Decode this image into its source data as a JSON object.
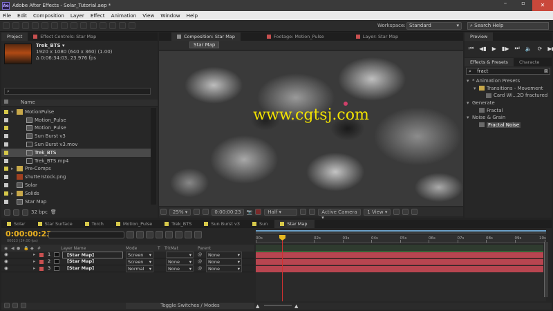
{
  "titlebar": {
    "icon": "after-effects-logo",
    "title": "Adobe After Effects - Solar_Tutorial.aep *"
  },
  "menu": [
    "File",
    "Edit",
    "Composition",
    "Layer",
    "Effect",
    "Animation",
    "View",
    "Window",
    "Help"
  ],
  "toolbar": {
    "workspace_label": "Workspace:",
    "workspace_value": "Standard",
    "search_placeholder": "Search Help"
  },
  "project_panel": {
    "tabs": [
      "Project",
      "Effect Controls: Star Map"
    ],
    "preview_name": "Trek_BTS",
    "preview_info": [
      "1920 x 1080  (640 x 360) (1.00)",
      "Δ 0:06:34:03, 23.976 fps"
    ],
    "column_header": "Name",
    "items": [
      {
        "label": "MotionPulse",
        "type": "folder",
        "color": "#d6c84a",
        "indent": 0,
        "expanded": true
      },
      {
        "label": "Motion_Pulse",
        "type": "comp",
        "color": "#c8c8c8",
        "indent": 1
      },
      {
        "label": "Motion_Pulse",
        "type": "comp",
        "color": "#d6c84a",
        "indent": 1
      },
      {
        "label": "Sun Burst v3",
        "type": "comp",
        "color": "#c8c8c8",
        "indent": 1
      },
      {
        "label": "Sun Burst v3.mov",
        "type": "footage",
        "color": "#c8c8c8",
        "indent": 1
      },
      {
        "label": "Trek_BTS",
        "type": "comp",
        "color": "#d6c84a",
        "indent": 1,
        "selected": true
      },
      {
        "label": "Trek_BTS.mp4",
        "type": "footage",
        "color": "#c8c8c8",
        "indent": 1
      },
      {
        "label": "Pre-Comps",
        "type": "folder",
        "color": "#d6c84a",
        "indent": 0
      },
      {
        "label": "shutterstock.png",
        "type": "image",
        "color": "#c8c8c8",
        "indent": 0
      },
      {
        "label": "Solar",
        "type": "comp",
        "color": "#c8c8c8",
        "indent": 0
      },
      {
        "label": "Solids",
        "type": "folder",
        "color": "#d6c84a",
        "indent": 0
      },
      {
        "label": "Star Map",
        "type": "comp",
        "color": "#c8c8c8",
        "indent": 0
      }
    ],
    "bpc": "32 bpc"
  },
  "viewer": {
    "tabs": [
      "Composition: Star Map",
      "Footage: Motion_Pulse",
      "Layer: Star Map"
    ],
    "tab_colors": [
      "#8c8c8c",
      "#c85050",
      "#c85050"
    ],
    "breadcrumb": "Star Map",
    "watermark": "www.cgtsj.com",
    "footer": {
      "zoom": "25%",
      "timecode": "0:00:00:23",
      "resolution": "Half",
      "camera": "Active Camera",
      "view": "1 View"
    }
  },
  "preview_panel": {
    "title": "Preview"
  },
  "effects_panel": {
    "tabs": [
      "Effects & Presets",
      "Characte"
    ],
    "search_value": "fract",
    "tree": [
      {
        "label": "* Animation Presets",
        "level": 0
      },
      {
        "label": "Transitions - Movement",
        "level": 1
      },
      {
        "label": "Card Wi...2D fractured",
        "level": 2
      },
      {
        "label": "Generate",
        "level": 0
      },
      {
        "label": "Fractal",
        "level": 1
      },
      {
        "label": "Noise & Grain",
        "level": 0
      },
      {
        "label": "Fractal Noise",
        "level": 1,
        "selected": true
      }
    ]
  },
  "timeline": {
    "tabs": [
      "Solar",
      "Star Surface",
      "Torch",
      "Motion_Pulse",
      "Trek_BTS",
      "Sun Burst v3",
      "Sun",
      "Star Map"
    ],
    "tab_colors": [
      "#d6c84a",
      "#d6c84a",
      "#d6c84a",
      "#d6c84a",
      "#d6c84a",
      "#d6c84a",
      "#d6c84a",
      "#d6c84a"
    ],
    "timecode": "0:00:00:23",
    "frame_info": "00023 (24.00 fps)",
    "columns": {
      "layer_name": "Layer Name",
      "mode": "Mode",
      "t": "T",
      "trkmat": "TrkMat",
      "parent": "Parent"
    },
    "layers": [
      {
        "num": "1",
        "name": "[Star Map]",
        "mode": "Screen",
        "trkmat": "",
        "parent": "None"
      },
      {
        "num": "2",
        "name": "[Star Map]",
        "mode": "Screen",
        "trkmat": "None",
        "parent": "None"
      },
      {
        "num": "3",
        "name": "[Star Map]",
        "mode": "Normal",
        "trkmat": "None",
        "parent": "None"
      }
    ],
    "ruler": [
      "00s",
      "02s",
      "03s",
      "04s",
      "05s",
      "06s",
      "07s",
      "08s",
      "09s",
      "10s"
    ],
    "toggle_label": "Toggle Switches / Modes"
  }
}
